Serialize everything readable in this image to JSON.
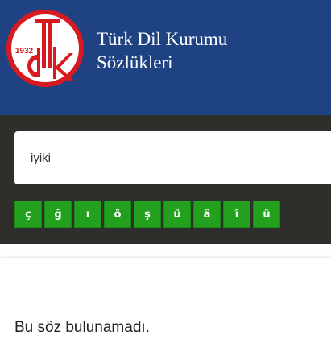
{
  "header": {
    "logo_year": "1932",
    "title_line1": "Türk Dil Kurumu",
    "title_line2": "Sözlükleri"
  },
  "search": {
    "value": "iyiki"
  },
  "special_chars": [
    "ç",
    "ğ",
    "ı",
    "ö",
    "ş",
    "ü",
    "â",
    "î",
    "û"
  ],
  "result": {
    "message": "Bu söz bulunamadı."
  },
  "colors": {
    "header_bg": "#1f4382",
    "search_band_bg": "#2e2f2b",
    "char_button_bg": "#22a01e",
    "logo_red": "#d71a21"
  }
}
